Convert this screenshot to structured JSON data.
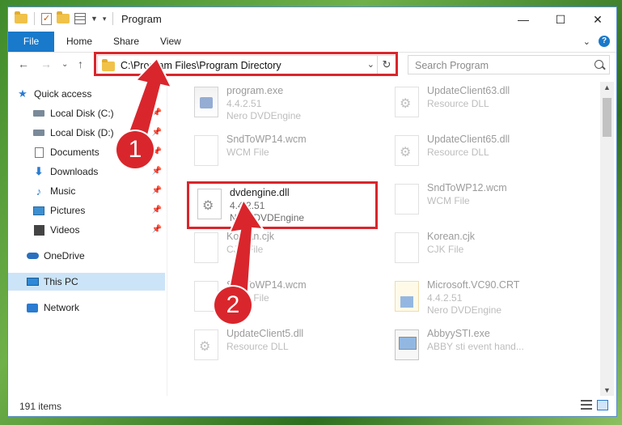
{
  "window": {
    "title": "Program",
    "controls": {
      "minimize": "—",
      "maximize": "☐",
      "close": "✕"
    }
  },
  "ribbon": {
    "tabs": [
      "File",
      "Home",
      "Share",
      "View"
    ],
    "help": "?"
  },
  "nav": {
    "address": "C:\\Program Files\\Program Directory",
    "search_placeholder": "Search Program"
  },
  "sidebar": {
    "items": [
      {
        "label": "Quick access",
        "icon": "star-icon"
      },
      {
        "label": "Local Disk (C:)",
        "icon": "disk-icon",
        "pinned": true
      },
      {
        "label": "Local Disk (D:)",
        "icon": "disk-icon",
        "pinned": true
      },
      {
        "label": "Documents",
        "icon": "documents-icon",
        "pinned": true
      },
      {
        "label": "Downloads",
        "icon": "downloads-icon",
        "pinned": true
      },
      {
        "label": "Music",
        "icon": "music-icon",
        "pinned": true
      },
      {
        "label": "Pictures",
        "icon": "pictures-icon",
        "pinned": true
      },
      {
        "label": "Videos",
        "icon": "videos-icon",
        "pinned": true
      },
      {
        "label": "OneDrive",
        "icon": "onedrive-icon"
      },
      {
        "label": "This PC",
        "icon": "this-pc-icon",
        "selected": true
      },
      {
        "label": "Network",
        "icon": "network-icon"
      }
    ]
  },
  "files": [
    {
      "name": "program.exe",
      "line2": "4.4.2.51",
      "line3": "Nero DVDEngine",
      "icon": "exe"
    },
    {
      "name": "UpdateClient63.dll",
      "line2": "Resource DLL",
      "line3": "",
      "icon": "gear"
    },
    {
      "name": "SndToWP14.wcm",
      "line2": "WCM File",
      "line3": "",
      "icon": "blank"
    },
    {
      "name": "UpdateClient65.dll",
      "line2": "Resource DLL",
      "line3": "",
      "icon": "gear"
    },
    {
      "name": "dvdengine.dll",
      "line2": "4.4.2.51",
      "line3": "Nero DVDEngine",
      "icon": "gear",
      "highlighted": true
    },
    {
      "name": "SndToWP12.wcm",
      "line2": "WCM File",
      "line3": "",
      "icon": "blank"
    },
    {
      "name": "Korean.cjk",
      "line2": "CJK File",
      "line3": "",
      "icon": "blank"
    },
    {
      "name": "Korean.cjk",
      "line2": "CJK File",
      "line3": "",
      "icon": "blank"
    },
    {
      "name": "SndToWP14.wcm",
      "line2": "WCM File",
      "line3": "",
      "icon": "blank"
    },
    {
      "name": "Microsoft.VC90.CRT",
      "line2": "4.4.2.51",
      "line3": "Nero DVDEngine",
      "icon": "msi"
    },
    {
      "name": "UpdateClient5.dll",
      "line2": "Resource DLL",
      "line3": "",
      "icon": "gear"
    },
    {
      "name": "AbbyySTI.exe",
      "line2": "ABBY sti event hand...",
      "line3": "",
      "icon": "mon"
    }
  ],
  "status": {
    "count": "191 items"
  },
  "annotations": {
    "step1": "1",
    "step2": "2",
    "color": "#d9262c"
  }
}
